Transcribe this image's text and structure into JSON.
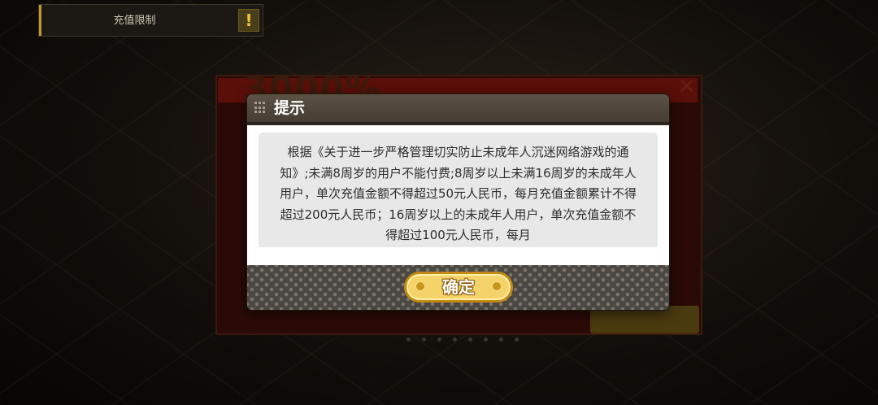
{
  "topbar": {
    "label": "充值限制",
    "warning_icon": "exclamation-icon",
    "accent_color": "#c29a2a"
  },
  "background": {
    "banner_text": "3000%",
    "close_icon": "close-x-icon"
  },
  "modal": {
    "title": "提示",
    "title_icon": "grid-dots-icon",
    "message": "根据《关于进一步严格管理切实防止未成年人沉迷网络游戏的通知》;未满8周岁的用户不能付费;8周岁以上未满16周岁的未成年人用户，单次充值金额不得超过50元人民币，每月充值金额累计不得超过200元人民币；16周岁以上的未成年人用户，单次充值金额不得超过100元人民币，每月",
    "confirm_label": "确定",
    "confirm_color": "#f4d36a"
  }
}
